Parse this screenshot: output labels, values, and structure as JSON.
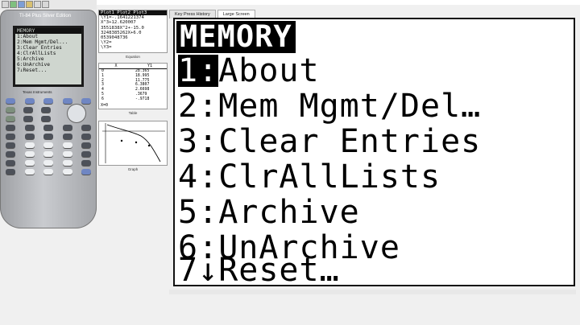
{
  "calculator": {
    "title": "TI-84 Plus Silver Edition",
    "brand": "Texas Instruments",
    "screen_lines": [
      "MEMORY",
      "1:About",
      "2:Mem Mgmt/Del...",
      "3:Clear Entries",
      "4:ClrAllLists",
      "5:Archive",
      "6:UnArchive",
      "7↓Reset..."
    ]
  },
  "equation_pane": {
    "lines": [
      "Plot1 Plot2 Plot3",
      "\\Y1=-.1641221374",
      "X^3+12.620007",
      "3551838X^2+-15.0",
      "3248385262X+6.0",
      "0539048736",
      "\\Y2=",
      "\\Y3="
    ],
    "caption": "Equation"
  },
  "table_pane": {
    "headers": [
      "X",
      "Y1"
    ],
    "rows": [
      [
        "0",
        "28.365"
      ],
      [
        "1",
        "18.995"
      ],
      [
        "2",
        "11.775"
      ],
      [
        "3",
        "6.3807"
      ],
      [
        "4",
        "2.6698"
      ],
      [
        "5",
        ".3679"
      ],
      [
        "6",
        "-.9718"
      ]
    ],
    "footer": "X=0",
    "caption": "Table"
  },
  "graph_pane": {
    "caption": "Graph"
  },
  "tabs": [
    "Key Press History",
    "Large Screen"
  ],
  "large_screen": {
    "title": "MEMORY",
    "items": [
      {
        "num": "1",
        "sep": ":",
        "label": "About"
      },
      {
        "num": "2",
        "sep": ":",
        "label": "Mem Mgmt/Del…"
      },
      {
        "num": "3",
        "sep": ":",
        "label": "Clear Entries"
      },
      {
        "num": "4",
        "sep": ":",
        "label": "ClrAllLists"
      },
      {
        "num": "5",
        "sep": ":",
        "label": "Archive"
      },
      {
        "num": "6",
        "sep": ":",
        "label": "UnArchive"
      },
      {
        "num": "7",
        "sep": "↓",
        "label": "Reset…"
      }
    ],
    "selected_index": 0
  }
}
